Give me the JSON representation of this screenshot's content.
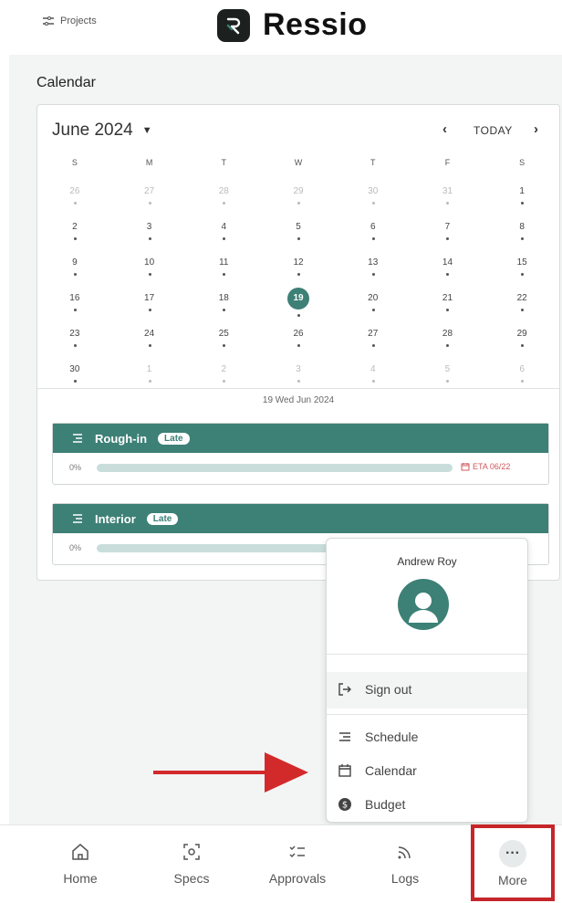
{
  "header": {
    "projects_label": "Projects",
    "app_name": "Ressio"
  },
  "section_title": "Calendar",
  "calendar": {
    "month_label": "June 2024",
    "today_label": "TODAY",
    "weekdays": [
      "S",
      "M",
      "T",
      "W",
      "T",
      "F",
      "S"
    ],
    "weeks": [
      [
        "26",
        "27",
        "28",
        "29",
        "30",
        "31",
        "1"
      ],
      [
        "2",
        "3",
        "4",
        "5",
        "6",
        "7",
        "8"
      ],
      [
        "9",
        "10",
        "11",
        "12",
        "13",
        "14",
        "15"
      ],
      [
        "16",
        "17",
        "18",
        "19",
        "20",
        "21",
        "22"
      ],
      [
        "23",
        "24",
        "25",
        "26",
        "27",
        "28",
        "29"
      ],
      [
        "30",
        "1",
        "2",
        "3",
        "4",
        "5",
        "6"
      ]
    ],
    "selected_day": "19",
    "selected_date_label": "19 Wed Jun 2024"
  },
  "tasks": [
    {
      "name": "Rough-in",
      "badge": "Late",
      "progress_label": "0%",
      "progress": 0,
      "eta": "ETA 06/22"
    },
    {
      "name": "Interior",
      "badge": "Late",
      "progress_label": "0%",
      "progress": 0,
      "eta": ""
    }
  ],
  "popup": {
    "user_name": "Andrew Roy",
    "sign_out": "Sign out",
    "items": [
      "Schedule",
      "Calendar",
      "Budget"
    ]
  },
  "bottom_nav": {
    "home": "Home",
    "specs": "Specs",
    "approvals": "Approvals",
    "logs": "Logs",
    "more": "More"
  },
  "colors": {
    "accent": "#3d8076",
    "late_red": "#d0585d",
    "highlight_red": "#c6262a"
  }
}
